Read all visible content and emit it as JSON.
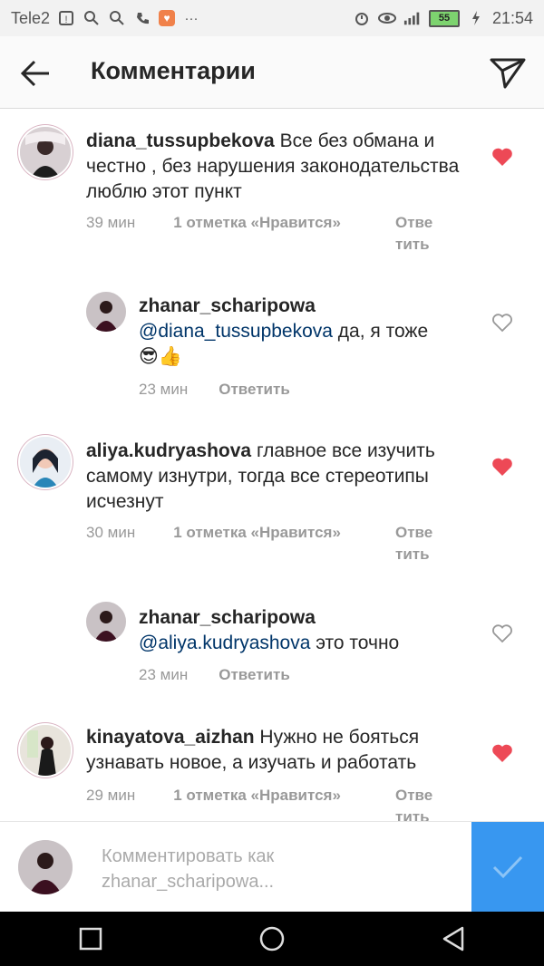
{
  "status_bar": {
    "carrier": "Tele2",
    "battery": "55",
    "time": "21:54"
  },
  "header": {
    "title": "Комментарии"
  },
  "comments": [
    {
      "username": "diana_tussupbekova",
      "text": " Все без обмана и честно , без нарушения законодательства люблю этот пункт",
      "time": "39 мин",
      "likes": "1 отметка «Нравится»",
      "reply": "Ответить",
      "reply_wrapped": [
        "Отве",
        "тить"
      ],
      "liked": true,
      "replies": [
        {
          "username": "zhanar_scharipowa",
          "mention": "@diana_tussupbekova",
          "text": " да, я тоже",
          "emoji": "😎👍",
          "time": "23 мин",
          "reply": "Ответить",
          "liked": false
        }
      ]
    },
    {
      "username": "aliya.kudryashova",
      "text": " главное все изучить самому изнутри, тогда все стереотипы исчезнут",
      "time": "30 мин",
      "likes": "1 отметка «Нравится»",
      "reply": "Ответить",
      "reply_wrapped": [
        "Отве",
        "тить"
      ],
      "liked": true,
      "replies": [
        {
          "username": "zhanar_scharipowa",
          "mention": "@aliya.kudryashova",
          "text": " это точно",
          "time": "23 мин",
          "reply": "Ответить",
          "liked": false
        }
      ]
    },
    {
      "username": "kinayatova_aizhan",
      "text": " Нужно не бояться узнавать новое, а изучать и работать",
      "time": "29 мин",
      "likes": "1 отметка «Нравится»",
      "reply": "Ответить",
      "reply_wrapped": [
        "Отве",
        "тить"
      ],
      "liked": true
    }
  ],
  "composer": {
    "placeholder_line1": "Комментировать как",
    "placeholder_line2": "zhanar_scharipowa..."
  },
  "colors": {
    "accent_blue": "#3897f0",
    "heart_red": "#ed4956",
    "mention_blue": "#003569"
  }
}
